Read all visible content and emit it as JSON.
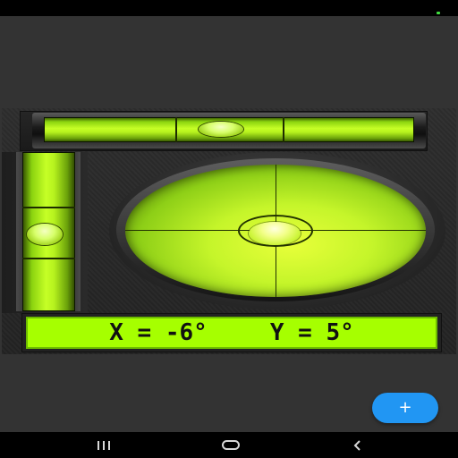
{
  "readout": {
    "x_text": "X = -6°",
    "y_text": "Y = 5°"
  },
  "fab": {
    "icon": "plus-icon",
    "label": "+"
  },
  "nav": {
    "recents_icon": "recents-icon",
    "home_icon": "home-icon",
    "back_icon": "back-icon"
  },
  "colors": {
    "fluid": "#a6ff00",
    "fab": "#2196f3",
    "background": "#333333"
  }
}
